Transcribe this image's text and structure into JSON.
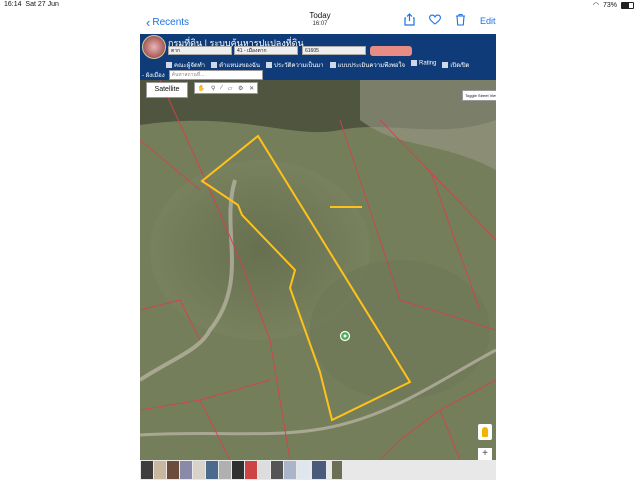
{
  "status_bar": {
    "time": "16:14",
    "date": "Sat 27 Jun",
    "battery": "73%"
  },
  "nav": {
    "back_label": "Recents",
    "title": "Today",
    "subtitle": "16:07",
    "edit_label": "Edit"
  },
  "website": {
    "title": "กรมที่ดิน | ระบบค้นหารูปแปลงที่ดิน",
    "province_select": "ตาก",
    "district_select": "41 - เมืองตาก",
    "parcel_input": "61605",
    "menu_items": [
      "คณะผู้จัดทำ",
      "ตำแหน่งของฉัน",
      "ประวัติความเป็นมา",
      "แบบประเมินความพึงพอใจ",
      "Rating",
      "เปิด/ปิด"
    ],
    "menu_row2_prefix": "- ผังเมือง",
    "menu_input_placeholder": "ค้นหาสถานที่..."
  },
  "map": {
    "satellite_label": "Satellite",
    "street_view_label": "Toggle Street View",
    "zoom_in_label": "+"
  },
  "colors": {
    "header_bg": "#0f3c78",
    "parcel_outline": "#ffc21a",
    "boundary_lines": "#d6404a",
    "ios_blue": "#1a73e8"
  }
}
